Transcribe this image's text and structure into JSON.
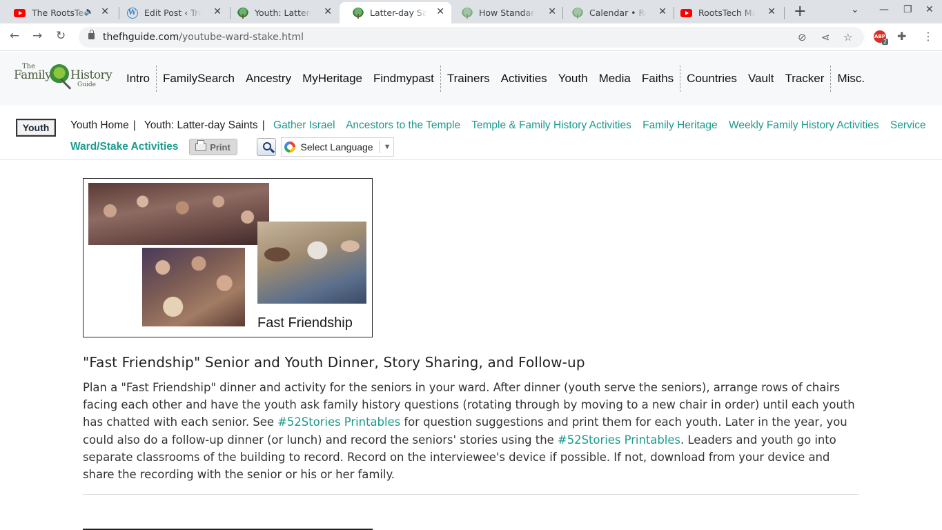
{
  "browser": {
    "tabs": [
      {
        "title": "The RootsTech",
        "favicon": "youtube-icon",
        "muted": true
      },
      {
        "title": "Edit Post ‹ Tree of",
        "favicon": "wordpress-icon"
      },
      {
        "title": "Youth: Latter-day",
        "favicon": "tree-icon"
      },
      {
        "title": "Latter-day Saint",
        "favicon": "tree-icon",
        "active": true
      },
      {
        "title": "How Standardize",
        "favicon": "tree-icon"
      },
      {
        "title": "Calendar • Roots",
        "favicon": "tree-icon"
      },
      {
        "title": "RootsTech Main",
        "favicon": "youtube-icon"
      }
    ],
    "url_host": "thefhguide.com",
    "url_path": "/youtube-ward-stake.html",
    "extension_badge_count": "2",
    "extension_badge_label": "ABP"
  },
  "logo": {
    "line1": "The",
    "line2a": "Family",
    "line2b": "History",
    "line3": "Guide"
  },
  "nav": {
    "items": [
      "Intro",
      "FamilySearch",
      "Ancestry",
      "MyHeritage",
      "Findmypast",
      "Trainers",
      "Activities",
      "Youth",
      "Media",
      "Faiths",
      "Countries",
      "Vault",
      "Tracker",
      "Misc."
    ]
  },
  "subnav": {
    "section_button": "Youth",
    "youth_home": "Youth Home",
    "current": "Youth: Latter-day Saints",
    "links": [
      "Gather Israel",
      "Ancestors to the Temple",
      "Temple & Family History Activities",
      "Family Heritage",
      "Weekly Family History Activities",
      "Service"
    ],
    "ward_stake": "Ward/Stake Activities",
    "print_label": "Print",
    "language_label": "Select Language",
    "language_arrow": "▼"
  },
  "content": {
    "image_caption": "Fast Friendship",
    "heading": "\"Fast Friendship\" Senior and Youth Dinner, Story Sharing, and Follow-up",
    "para_part1": "Plan a \"Fast Friendship\" dinner and activity for the seniors in your ward. After dinner (youth serve the seniors), arrange rows of chairs facing each other and have the youth ask family history questions (rotating through by moving to a new chair in order) until each youth has chatted with each senior. See ",
    "link1": "#52Stories Printables",
    "para_part2": " for question suggestions and print them for each youth. Later in the year, you could also do a follow-up dinner (or lunch) and record the seniors' stories using the ",
    "link2": "#52Stories Printables",
    "para_part3": ". Leaders and youth go into separate classrooms of the building to record. Record on the interviewee's device if possible. If not, download from your device and share the recording with the senior or his or her family."
  },
  "colors": {
    "link": "#1b9a8c",
    "tabstrip": "#dee1e6",
    "header_bg": "#f7f8f9"
  }
}
